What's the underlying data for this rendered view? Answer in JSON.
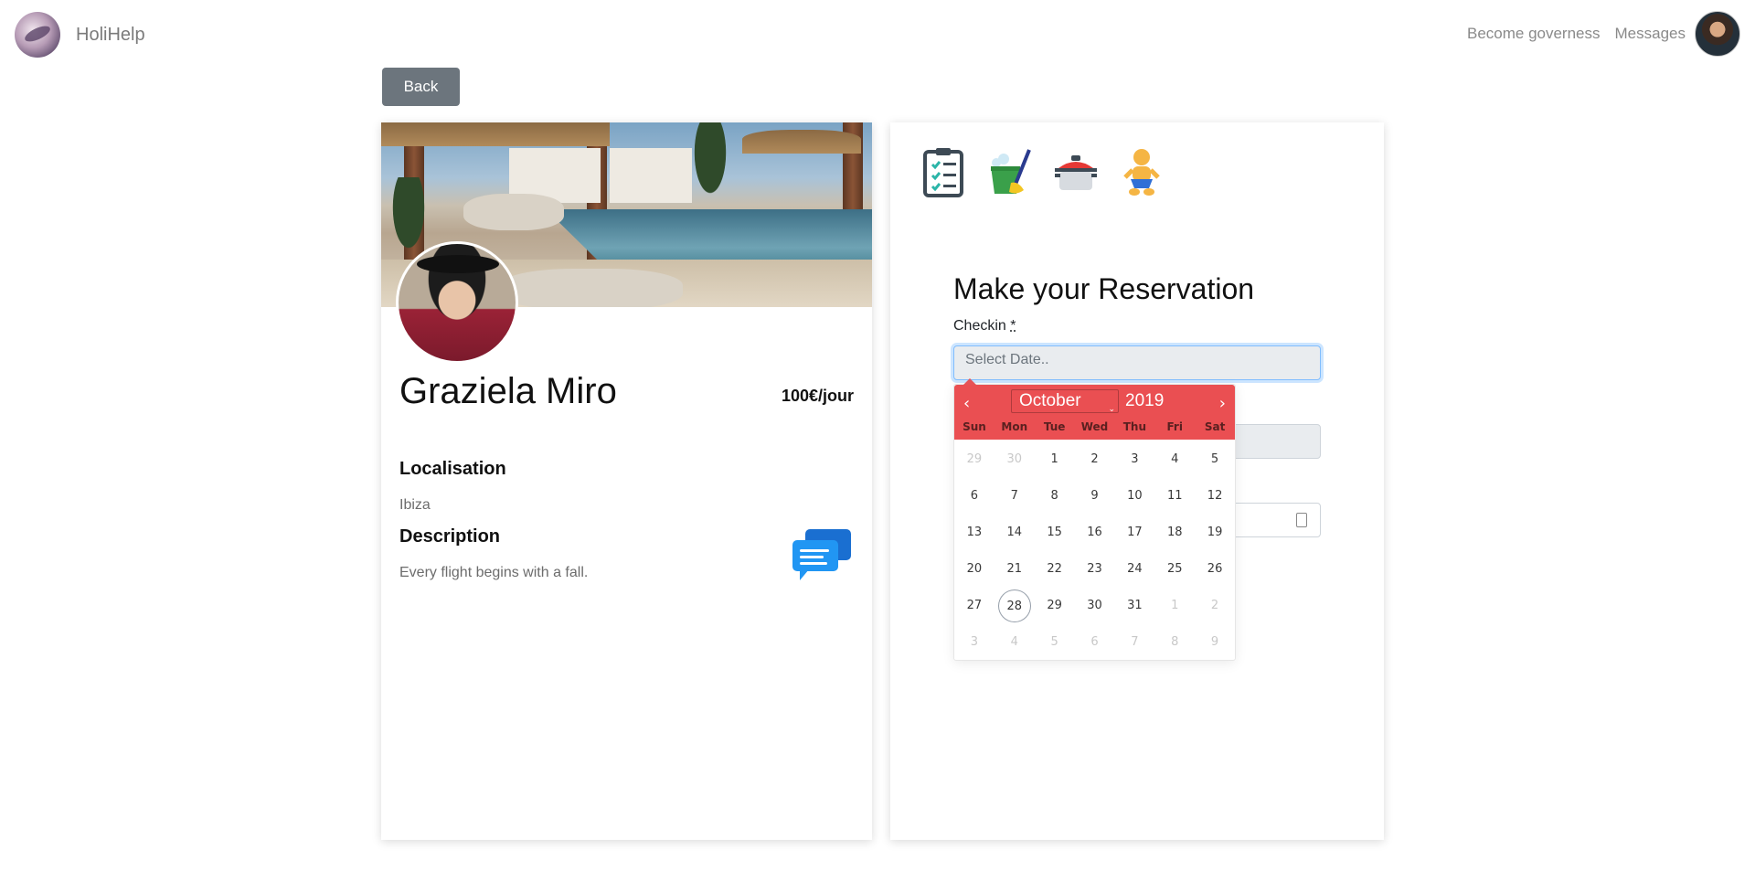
{
  "nav": {
    "brand": "HoliHelp",
    "links": [
      "Become governess",
      "Messages"
    ]
  },
  "back_button": "Back",
  "profile": {
    "name": "Graziela Miro",
    "price": "100€/jour",
    "localisation_title": "Localisation",
    "localisation_value": "Ibiza",
    "description_title": "Description",
    "description_value": "Every flight begins with a fall."
  },
  "reservation": {
    "title": "Make your Reservation",
    "checkin_label": "Checkin",
    "required_mark": "*",
    "checkin_placeholder": "Select Date..",
    "service_icons": [
      "clipboard-checklist-icon",
      "cleaning-bucket-icon",
      "cooking-pot-icon",
      "baby-icon"
    ]
  },
  "calendar": {
    "month": "October",
    "year": "2019",
    "weekdays": [
      "Sun",
      "Mon",
      "Tue",
      "Wed",
      "Thu",
      "Fri",
      "Sat"
    ],
    "days": [
      {
        "d": "29",
        "m": true
      },
      {
        "d": "30",
        "m": true
      },
      {
        "d": "1"
      },
      {
        "d": "2"
      },
      {
        "d": "3"
      },
      {
        "d": "4"
      },
      {
        "d": "5"
      },
      {
        "d": "6"
      },
      {
        "d": "7"
      },
      {
        "d": "8"
      },
      {
        "d": "9"
      },
      {
        "d": "10"
      },
      {
        "d": "11"
      },
      {
        "d": "12"
      },
      {
        "d": "13"
      },
      {
        "d": "14"
      },
      {
        "d": "15"
      },
      {
        "d": "16"
      },
      {
        "d": "17"
      },
      {
        "d": "18"
      },
      {
        "d": "19"
      },
      {
        "d": "20"
      },
      {
        "d": "21"
      },
      {
        "d": "22"
      },
      {
        "d": "23"
      },
      {
        "d": "24"
      },
      {
        "d": "25"
      },
      {
        "d": "26"
      },
      {
        "d": "27"
      },
      {
        "d": "28",
        "today": true
      },
      {
        "d": "29"
      },
      {
        "d": "30"
      },
      {
        "d": "31"
      },
      {
        "d": "1",
        "m": true
      },
      {
        "d": "2",
        "m": true
      },
      {
        "d": "3",
        "m": true
      },
      {
        "d": "4",
        "m": true
      },
      {
        "d": "5",
        "m": true
      },
      {
        "d": "6",
        "m": true
      },
      {
        "d": "7",
        "m": true
      },
      {
        "d": "8",
        "m": true
      },
      {
        "d": "9",
        "m": true
      }
    ],
    "accent_color": "#ea4f52"
  }
}
